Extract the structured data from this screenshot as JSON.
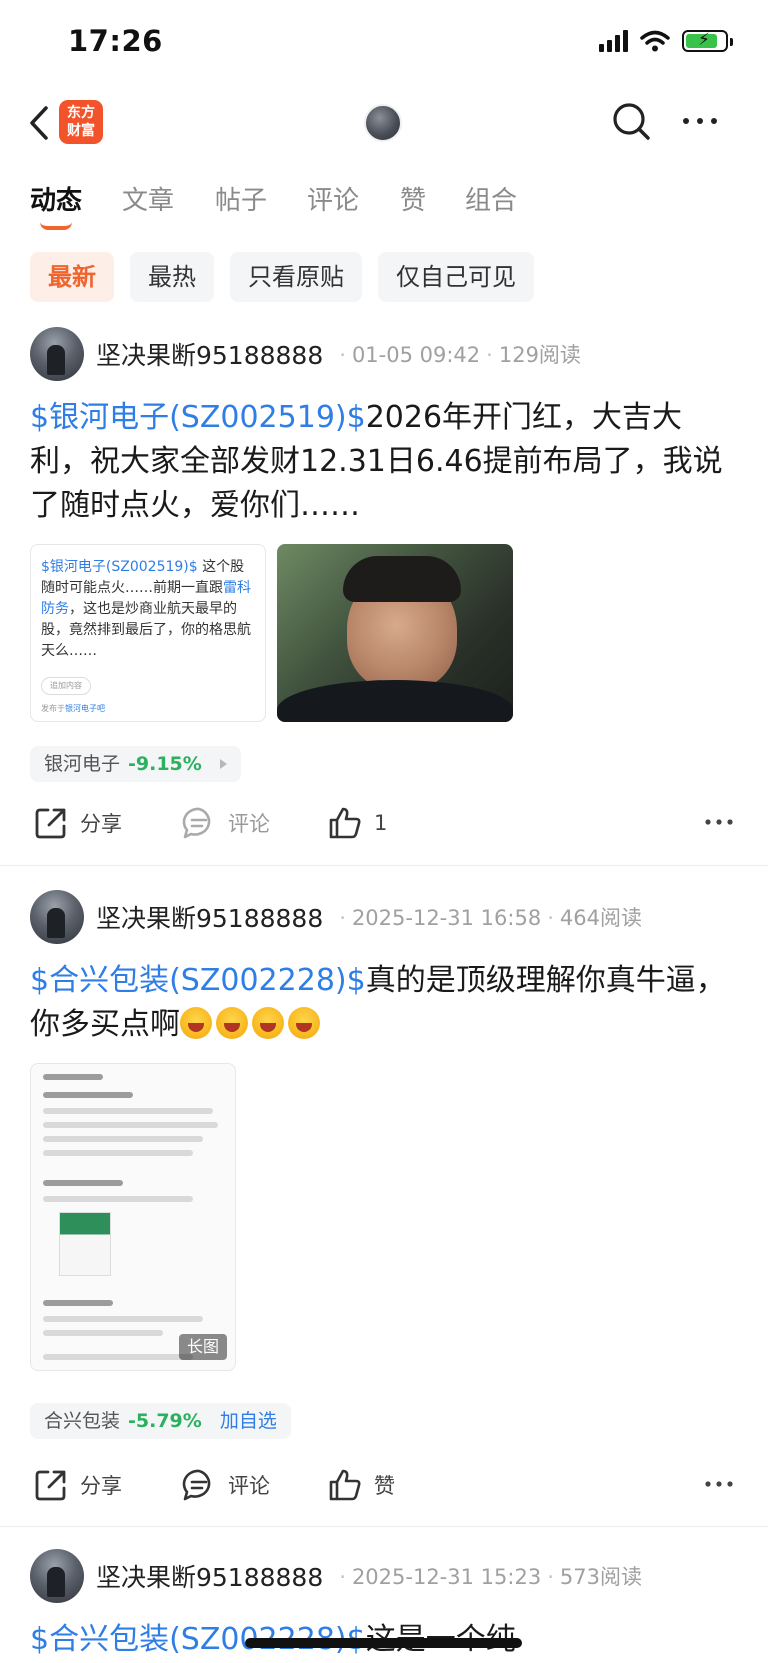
{
  "status": {
    "time": "17:26"
  },
  "nav": {
    "logo_line1": "东方",
    "logo_line2": "财富"
  },
  "tabs": [
    "动态",
    "文章",
    "帖子",
    "评论",
    "赞",
    "组合"
  ],
  "filters": [
    "最新",
    "最热",
    "只看原贴",
    "仅自己可见"
  ],
  "posts": [
    {
      "username": "坚决果断95188888",
      "time": "01-05 09:42",
      "reads": "129阅读",
      "tag": "$银河电子(SZ002519)$",
      "body": "2026年开门红，大吉大利，祝大家全部发财12.31日6.46提前布局了，我说了随时点火，爱你们……",
      "quote": {
        "tag": "$银河电子(SZ002519)$",
        "text_a": "  这个股随时可能点火……前期一直跟",
        "link": "雷科防务",
        "text_b": "，这也是炒商业航天最早的股，竟然排到最后了，你的格思航天么……",
        "pill": "追加内容",
        "foot_prefix": "发布于",
        "foot_link": "银河电子吧"
      },
      "stock": {
        "name": "银河电子",
        "change": "-9.15%"
      },
      "actions": {
        "share": "分享",
        "comment": "评论",
        "like": "1"
      }
    },
    {
      "username": "坚决果断95188888",
      "time": "2025-12-31 16:58",
      "reads": "464阅读",
      "tag": "$合兴包装(SZ002228)$",
      "body": "真的是顶级理解你真牛逼，你多买点啊",
      "long_badge": "长图",
      "stock": {
        "name": "合兴包装",
        "change": "-5.79%",
        "add": "加自选"
      },
      "actions": {
        "share": "分享",
        "comment": "评论",
        "like": "赞"
      }
    },
    {
      "username": "坚决果断95188888",
      "time": "2025-12-31 15:23",
      "reads": "573阅读",
      "tag": "$合兴包装(SZ002228)$",
      "body": "这是一个纯"
    }
  ]
}
